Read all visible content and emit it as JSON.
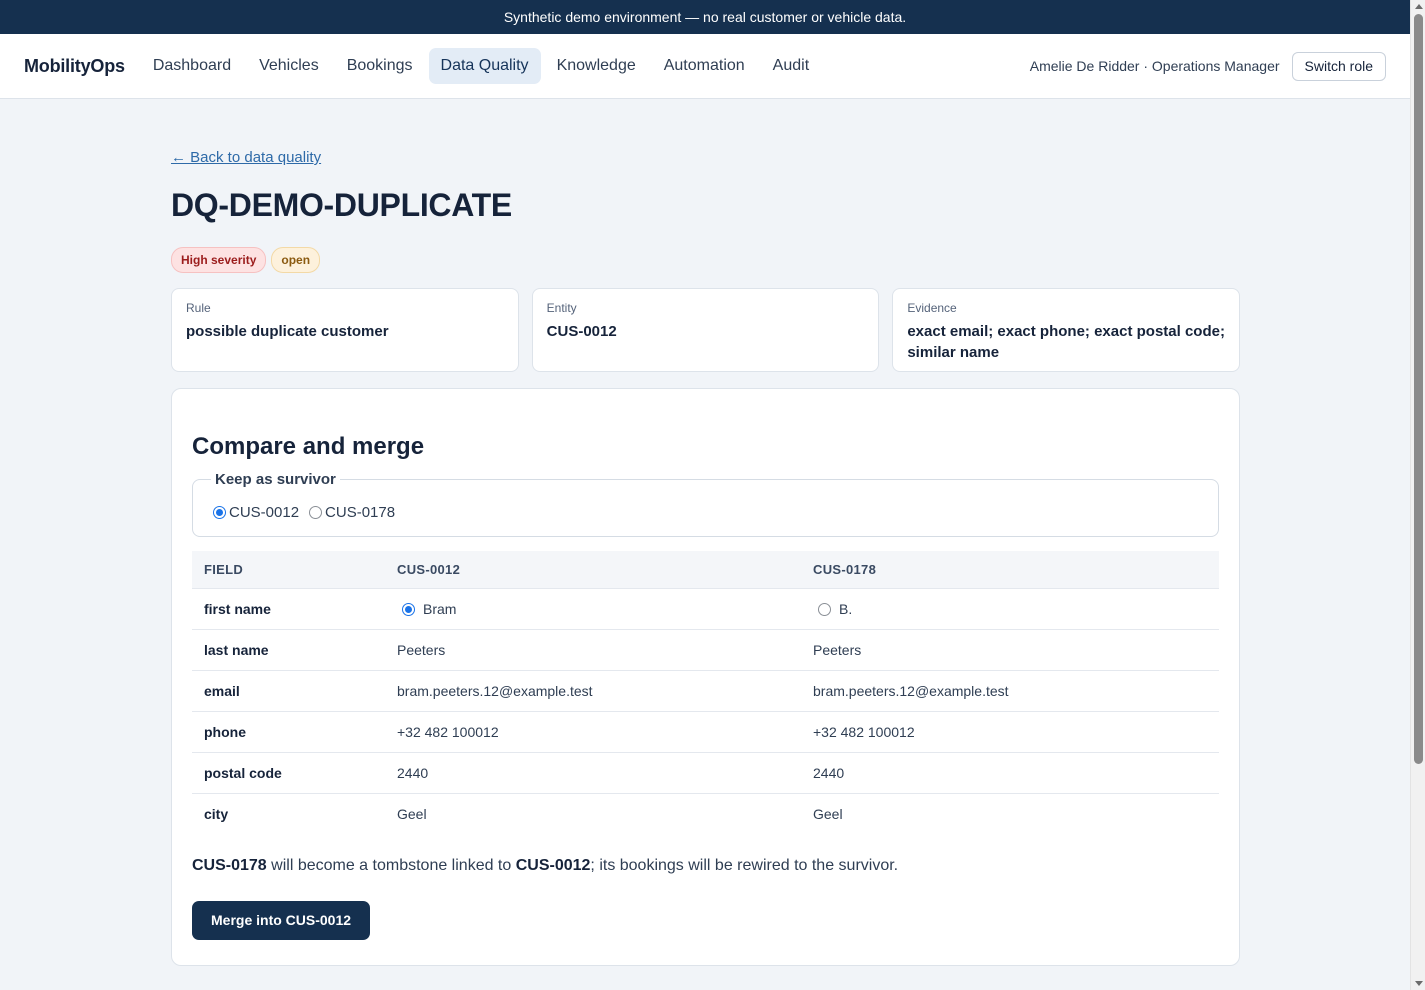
{
  "banner": {
    "text": "Synthetic demo environment — no real customer or vehicle data."
  },
  "nav": {
    "brand": "MobilityOps",
    "links": [
      {
        "label": "Dashboard"
      },
      {
        "label": "Vehicles"
      },
      {
        "label": "Bookings"
      },
      {
        "label": "Data Quality",
        "active": true
      },
      {
        "label": "Knowledge"
      },
      {
        "label": "Automation"
      },
      {
        "label": "Audit"
      }
    ],
    "user": "Amelie De Ridder · Operations Manager",
    "switch_role": "Switch role"
  },
  "page": {
    "back_link": "← Back to data quality",
    "title": "DQ-DEMO-DUPLICATE",
    "badges": {
      "severity": "High severity",
      "status": "open"
    },
    "cards": {
      "rule": {
        "label": "Rule",
        "value": "possible duplicate customer"
      },
      "entity": {
        "label": "Entity",
        "value": "CUS-0012"
      },
      "evidence": {
        "label": "Evidence",
        "value": "exact email; exact phone; exact postal code; similar name"
      }
    }
  },
  "merge": {
    "title": "Compare and merge",
    "survivor_legend": "Keep as survivor",
    "survivor_options": [
      "CUS-0012",
      "CUS-0178"
    ],
    "survivor_selected": "CUS-0012",
    "table": {
      "headers": [
        "FIELD",
        "CUS-0012",
        "CUS-0178"
      ],
      "rows": [
        {
          "field": "first name",
          "a": "Bram",
          "b": "B.",
          "choice": "a"
        },
        {
          "field": "last name",
          "a": "Peeters",
          "b": "Peeters"
        },
        {
          "field": "email",
          "a": "bram.peeters.12@example.test",
          "b": "bram.peeters.12@example.test"
        },
        {
          "field": "phone",
          "a": "+32 482 100012",
          "b": "+32 482 100012"
        },
        {
          "field": "postal code",
          "a": "2440",
          "b": "2440"
        },
        {
          "field": "city",
          "a": "Geel",
          "b": "Geel"
        }
      ]
    },
    "note": {
      "loser": "CUS-0178",
      "mid": " will become a tombstone linked to ",
      "survivor": "CUS-0012",
      "tail": "; its bookings will be rewired to the survivor."
    },
    "button": "Merge into CUS-0012"
  }
}
